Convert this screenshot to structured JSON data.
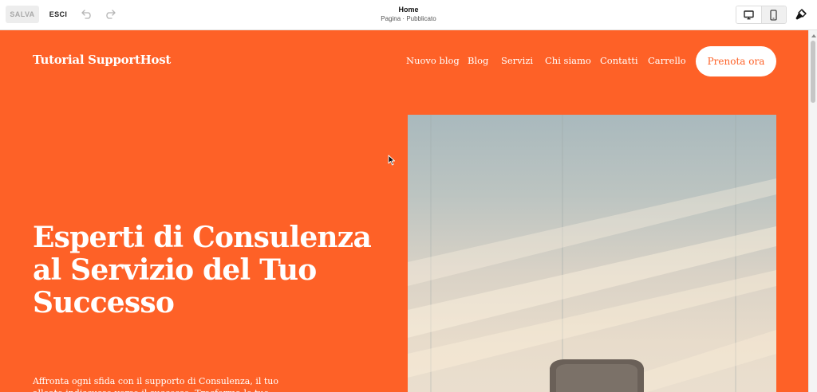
{
  "editor": {
    "save_label": "SALVA",
    "exit_label": "ESCI",
    "undo_icon": "undo-icon",
    "redo_icon": "redo-icon",
    "page_title": "Home",
    "page_status": "Pagina · Pubblicato",
    "devices": [
      {
        "name": "desktop-icon",
        "active": true
      },
      {
        "name": "mobile-icon",
        "active": false
      }
    ],
    "style_icon": "paintbrush-icon"
  },
  "site": {
    "brand": "Tutorial SupportHost",
    "nav": [
      "Nuovo blog",
      "Blog",
      "Servizi",
      "Chi siamo",
      "Contatti",
      "Carrello"
    ],
    "cta_label": "Prenota ora",
    "hero_title": "Esperti di Consulenza al Servizio del Tuo Successo",
    "hero_text": "Affronta ogni sfida con il supporto di Consulenza, il tuo alleato indiscusso verso il successo. Trasforma le tue idee in una",
    "accent_color": "#fe6127",
    "text_color": "#ffffff"
  }
}
